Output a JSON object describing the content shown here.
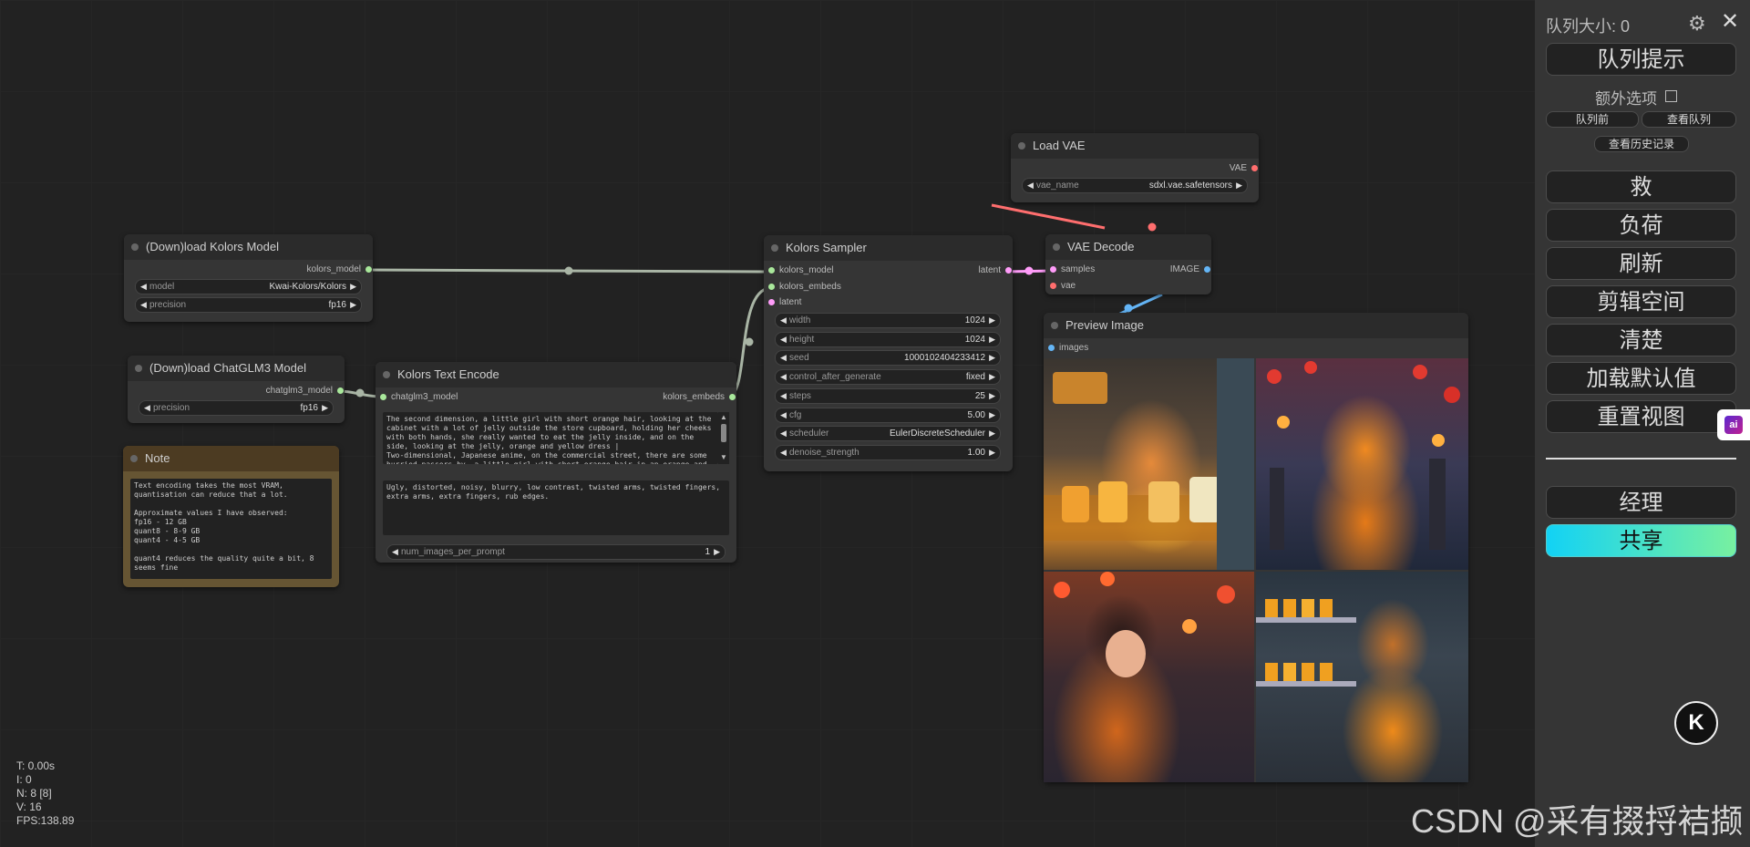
{
  "stats": {
    "t": "T: 0.00s",
    "i": "I: 0",
    "n": "N: 8 [8]",
    "v": "V: 16",
    "fps": "FPS:138.89"
  },
  "nodes": {
    "load_kolors": {
      "title": "(Down)load Kolors Model",
      "output": "kolors_model",
      "model_label": "model",
      "model_value": "Kwai-Kolors/Kolors",
      "precision_label": "precision",
      "precision_value": "fp16"
    },
    "load_chatglm": {
      "title": "(Down)load ChatGLM3 Model",
      "output": "chatglm3_model",
      "precision_label": "precision",
      "precision_value": "fp16"
    },
    "note": {
      "title": "Note",
      "text": "Text encoding takes the most VRAM, quantisation can reduce that a lot.\n\nApproximate values I have observed:\nfp16 - 12 GB\nquant8 - 8-9 GB\nquant4 - 4-5 GB\n\nquant4 reduces the quality quite a bit, 8 seems fine"
    },
    "text_encode": {
      "title": "Kolors Text Encode",
      "input": "chatglm3_model",
      "output": "kolors_embeds",
      "prompt": "The second dimension, a little girl with short orange hair, looking at the cabinet with a lot of jelly outside the store cupboard, holding her cheeks with both hands, she really wanted to eat the jelly inside, and on the side, looking at the jelly, orange and yellow dress |\nTwo-dimensional, Japanese anime, on the commercial street, there are some hurried passers-by, a little girl with short orange hair in an orange and",
      "negative": "Ugly, distorted, noisy, blurry, low contrast, twisted arms, twisted fingers, extra arms, extra fingers, rub edges.",
      "num_label": "num_images_per_prompt",
      "num_value": "1"
    },
    "sampler": {
      "title": "Kolors Sampler",
      "in1": "kolors_model",
      "in2": "kolors_embeds",
      "in3": "latent",
      "output": "latent",
      "widgets": [
        {
          "label": "width",
          "value": "1024"
        },
        {
          "label": "height",
          "value": "1024"
        },
        {
          "label": "seed",
          "value": "1000102404233412"
        },
        {
          "label": "control_after_generate",
          "value": "fixed"
        },
        {
          "label": "steps",
          "value": "25"
        },
        {
          "label": "cfg",
          "value": "5.00"
        },
        {
          "label": "scheduler",
          "value": "EulerDiscreteScheduler"
        },
        {
          "label": "denoise_strength",
          "value": "1.00"
        }
      ]
    },
    "load_vae": {
      "title": "Load VAE",
      "output": "VAE",
      "vae_label": "vae_name",
      "vae_value": "sdxl.vae.safetensors"
    },
    "vae_decode": {
      "title": "VAE Decode",
      "in1": "samples",
      "in2": "vae",
      "output": "IMAGE"
    },
    "preview": {
      "title": "Preview Image",
      "input": "images"
    }
  },
  "menu": {
    "queue_size": "队列大小: 0",
    "queue_prompt": "队列提示",
    "extra_options": "额外选项",
    "queue_front": "队列前",
    "view_queue": "查看队列",
    "view_history": "查看历史记录",
    "save": "救",
    "load": "负荷",
    "refresh": "刷新",
    "clipspace": "剪辑空间",
    "clear": "清楚",
    "load_default": "加载默认值",
    "reset_view": "重置视图",
    "manager": "经理",
    "share": "共享"
  },
  "watermark": "CSDN @采有掇捋袺撷",
  "colors": {
    "link_model": "#a9b5a5",
    "link_latent": "#ff9cf9",
    "link_vae": "#ff6e6e",
    "link_image": "#64b5f6",
    "share_from": "#12d2f5",
    "share_to": "#78f0a0"
  }
}
